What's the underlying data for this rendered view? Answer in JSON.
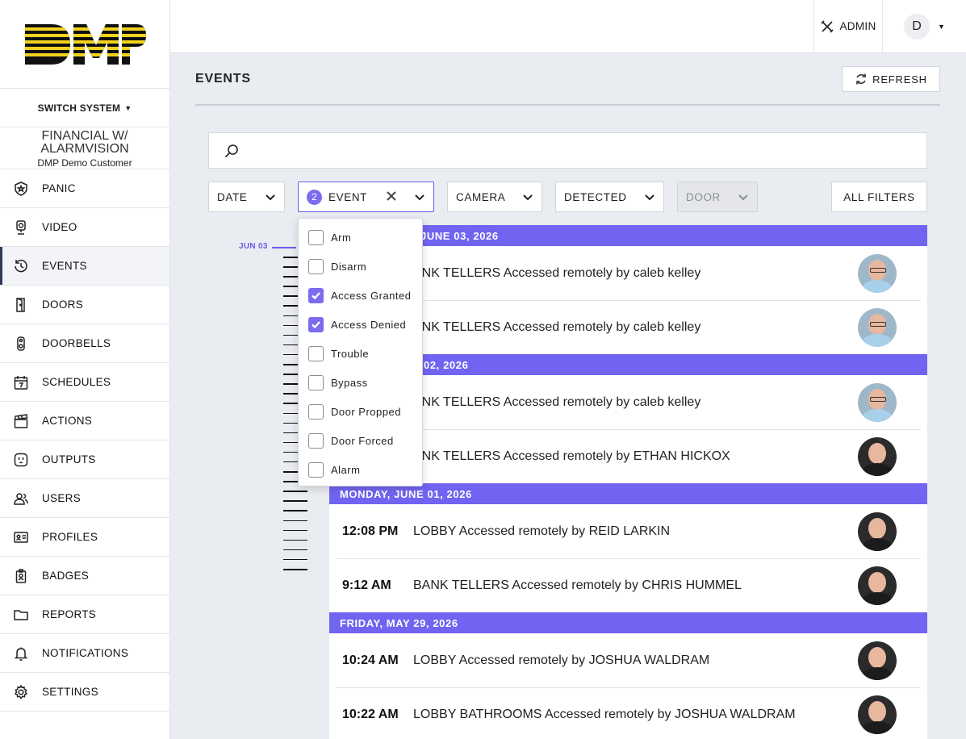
{
  "brand": {
    "logo_text": "DMP"
  },
  "sidebar": {
    "switch_label": "SWITCH SYSTEM",
    "system_name": "FINANCIAL W/ ALARMVISION",
    "customer": "DMP Demo Customer",
    "items": [
      {
        "label": "PANIC",
        "icon": "shield-star-icon"
      },
      {
        "label": "VIDEO",
        "icon": "camera-icon"
      },
      {
        "label": "EVENTS",
        "icon": "history-icon",
        "active": true
      },
      {
        "label": "DOORS",
        "icon": "door-icon"
      },
      {
        "label": "DOORBELLS",
        "icon": "doorbell-icon"
      },
      {
        "label": "SCHEDULES",
        "icon": "calendar-icon"
      },
      {
        "label": "ACTIONS",
        "icon": "clapperboard-icon"
      },
      {
        "label": "OUTPUTS",
        "icon": "outlet-icon"
      },
      {
        "label": "USERS",
        "icon": "users-icon"
      },
      {
        "label": "PROFILES",
        "icon": "id-card-icon"
      },
      {
        "label": "BADGES",
        "icon": "badge-icon"
      },
      {
        "label": "REPORTS",
        "icon": "folder-icon"
      },
      {
        "label": "NOTIFICATIONS",
        "icon": "bell-icon"
      },
      {
        "label": "SETTINGS",
        "icon": "gear-icon"
      }
    ]
  },
  "header": {
    "admin_label": "ADMIN",
    "user_initial": "D"
  },
  "main": {
    "title": "EVENTS",
    "refresh_label": "REFRESH",
    "search_placeholder": ""
  },
  "filters": {
    "date": "DATE",
    "event": "EVENT",
    "event_count": "2",
    "camera": "CAMERA",
    "detected": "DETECTED",
    "door": "DOOR",
    "all": "ALL FILTERS"
  },
  "event_dropdown": {
    "options": [
      {
        "label": "Arm",
        "checked": false
      },
      {
        "label": "Disarm",
        "checked": false
      },
      {
        "label": "Access Granted",
        "checked": true
      },
      {
        "label": "Access Denied",
        "checked": true
      },
      {
        "label": "Trouble",
        "checked": false
      },
      {
        "label": "Bypass",
        "checked": false
      },
      {
        "label": "Door Propped",
        "checked": false
      },
      {
        "label": "Door Forced",
        "checked": false
      },
      {
        "label": "Alarm",
        "checked": false
      }
    ]
  },
  "timeline": {
    "marker_label": "JUN 03"
  },
  "events": [
    {
      "date": "JUNE 03, 2026",
      "rows": [
        {
          "time": "",
          "desc": "ANK TELLERS Accessed remotely by caleb kelley",
          "photo": "glasses"
        },
        {
          "time": "",
          "desc": "ANK TELLERS Accessed remotely by caleb kelley",
          "photo": "glasses"
        }
      ]
    },
    {
      "date": "02, 2026",
      "rows": [
        {
          "time": "",
          "desc": "ANK TELLERS Accessed remotely by caleb kelley",
          "photo": "glasses"
        },
        {
          "time": "",
          "desc": "ANK TELLERS Accessed remotely by ETHAN HICKOX",
          "photo": "dark"
        }
      ]
    },
    {
      "date": "MONDAY, JUNE 01, 2026",
      "rows": [
        {
          "time": "12:08 PM",
          "desc": "LOBBY Accessed remotely by REID LARKIN",
          "photo": "dark"
        },
        {
          "time": "9:12 AM",
          "desc": "BANK TELLERS Accessed remotely by CHRIS HUMMEL",
          "photo": "dark"
        }
      ]
    },
    {
      "date": "FRIDAY, MAY 29, 2026",
      "rows": [
        {
          "time": "10:24 AM",
          "desc": "LOBBY Accessed remotely by JOSHUA WALDRAM",
          "photo": "dark"
        },
        {
          "time": "10:22 AM",
          "desc": "LOBBY BATHROOMS Accessed remotely by JOSHUA WALDRAM",
          "photo": "dark"
        }
      ]
    }
  ],
  "colors": {
    "accent": "#7164f0",
    "nav_active": "#2e3a59"
  }
}
